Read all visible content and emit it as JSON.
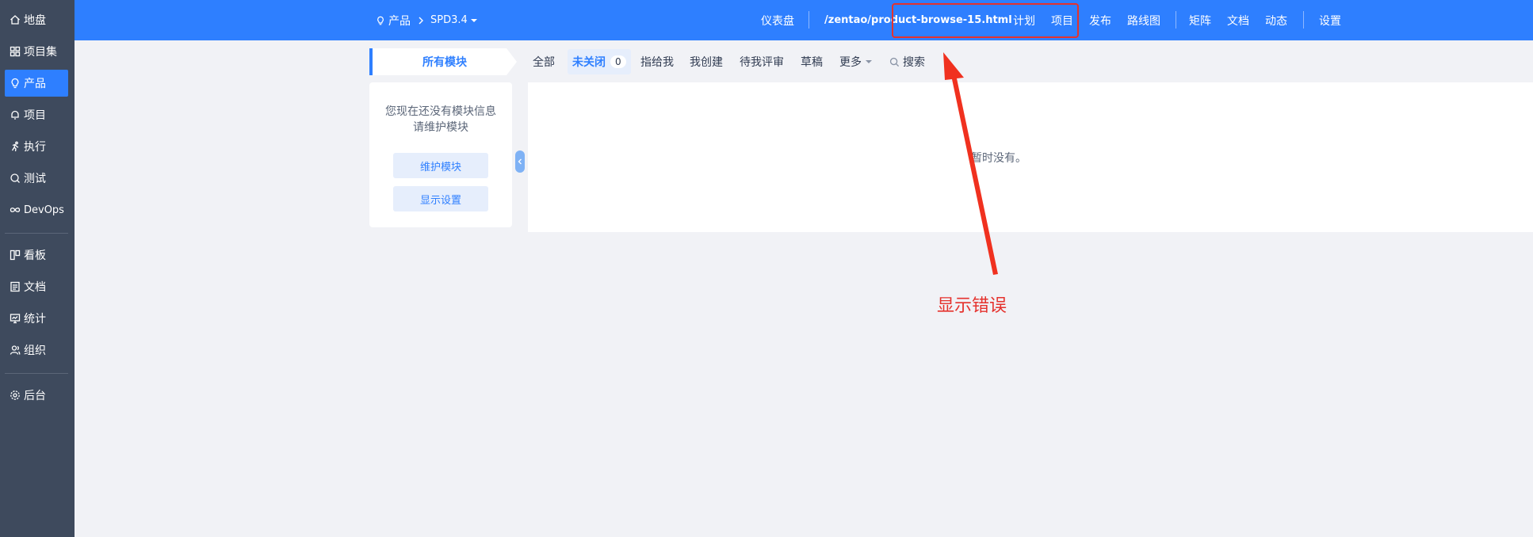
{
  "sidebar": {
    "items": [
      {
        "label": "地盘",
        "icon": "home-icon"
      },
      {
        "label": "项目集",
        "icon": "grid-icon"
      },
      {
        "label": "产品",
        "icon": "lightbulb-icon"
      },
      {
        "label": "项目",
        "icon": "bell-icon"
      },
      {
        "label": "执行",
        "icon": "run-icon"
      },
      {
        "label": "测试",
        "icon": "bug-icon"
      },
      {
        "label": "DevOps",
        "icon": "infinity-icon"
      },
      {
        "label": "看板",
        "icon": "kanban-icon"
      },
      {
        "label": "文档",
        "icon": "doc-icon"
      },
      {
        "label": "统计",
        "icon": "monitor-icon"
      },
      {
        "label": "组织",
        "icon": "users-icon"
      },
      {
        "label": "后台",
        "icon": "gear-icon"
      }
    ]
  },
  "header": {
    "breadcrumb_root": "产品",
    "breadcrumb_product": "SPD3.4",
    "nav": {
      "dashboard": "仪表盘",
      "url_text": "/zentao/product-browse-15.html",
      "plan": "计划",
      "project": "项目",
      "release": "发布",
      "roadmap": "路线图",
      "matrix": "矩阵",
      "doc": "文档",
      "dynamic": "动态",
      "settings": "设置"
    }
  },
  "toolbar": {
    "module_tab": "所有模块",
    "filters": {
      "all": "全部",
      "unclosed": "未关闭",
      "unclosed_count": "0",
      "assigned_to_me": "指给我",
      "created_by_me": "我创建",
      "to_review": "待我评审",
      "draft": "草稿",
      "more": "更多",
      "search": "搜索"
    }
  },
  "left_panel": {
    "message_line1": "您现在还没有模块信息",
    "message_line2": "请维护模块",
    "maintain_button": "维护模块",
    "display_settings_button": "显示设置"
  },
  "main_panel": {
    "empty_text": "暂时没有。"
  },
  "annotation": {
    "text": "显示错误",
    "color": "#e5322d"
  },
  "colors": {
    "primary": "#2e7fff",
    "sidebar_bg": "#3e4a5d",
    "page_bg": "#f1f2f6"
  }
}
